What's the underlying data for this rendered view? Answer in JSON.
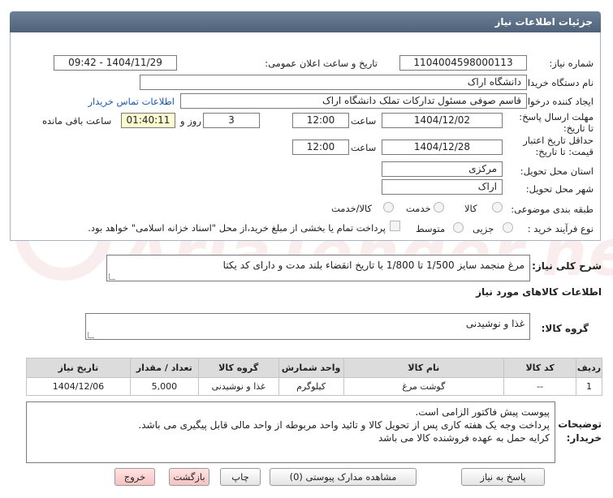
{
  "header": {
    "title": "جزئیات اطلاعات نیاز"
  },
  "form": {
    "need_number": {
      "label": "شماره نیاز:",
      "value": "1104004598000113"
    },
    "announce_datetime": {
      "label": "تاریخ و ساعت اعلان عمومی:",
      "value": "1404/11/29 - 09:42"
    },
    "buyer_org": {
      "label": "نام دستگاه خریدار:",
      "value": "دانشگاه اراک"
    },
    "requester": {
      "label": "ایجاد کننده درخواست:",
      "value": "قاسم صوفی مسئول تدارکات تملک دانشگاه اراک",
      "contact_link": "اطلاعات تماس خریدار"
    },
    "reply_deadline": {
      "label": "مهلت ارسال پاسخ: تا تاریخ:",
      "date": "1404/12/02",
      "time_label": "ساعت",
      "time": "12:00",
      "days": "3",
      "days_label": "روز و",
      "remaining": "01:40:11",
      "remaining_label": "ساعت باقی مانده"
    },
    "price_validity": {
      "label": "حداقل تاریخ اعتبار قیمت: تا تاریخ:",
      "date": "1404/12/28",
      "time_label": "ساعت",
      "time": "12:00"
    },
    "province": {
      "label": "استان محل تحویل:",
      "value": "مرکزی"
    },
    "city": {
      "label": "شهر محل تحویل:",
      "value": "اراک"
    },
    "category": {
      "label": "طبقه بندی موضوعی:",
      "options": [
        "کالا",
        "خدمت",
        "کالا/خدمت"
      ]
    },
    "process_type": {
      "label": "نوع فرآیند خرید :",
      "options": [
        "جزیی",
        "متوسط"
      ],
      "payment_note": "پرداخت تمام یا بخشی از مبلغ خرید،از محل \"اسناد خزانه اسلامی\" خواهد بود."
    }
  },
  "summary": {
    "label": "شرح کلی نیاز:",
    "value": "مرغ منجمد سایز 1/500 تا 1/800 با تاریخ انقضاء بلند مدت و دارای کد یکتا"
  },
  "goods_section": {
    "title": "اطلاعات کالاهای مورد نیاز"
  },
  "goods_group": {
    "label": "گروه کالا:",
    "value": "غذا و نوشیدنی"
  },
  "table": {
    "headers": [
      "ردیف",
      "کد کالا",
      "نام کالا",
      "واحد شمارش",
      "گروه کالا",
      "تعداد / مقدار",
      "تاریخ نیاز"
    ],
    "rows": [
      [
        "1",
        "--",
        "گوشت مرغ",
        "کیلوگرم",
        "غذا و نوشیدنی",
        "5,000",
        "1404/12/06"
      ]
    ]
  },
  "buyer_notes": {
    "label": "توضیحات خریدار:",
    "lines": [
      "پیوست پیش فاکتور الزامی است.",
      "پرداخت وجه یک هفته کاری پس از تحویل کالا و تائید واحد مربوطه از واحد مالی قابل پیگیری می باشد.",
      "کرایه حمل به عهده فروشنده کالا می باشد"
    ]
  },
  "buttons": {
    "reply": "پاسخ به نیاز",
    "view_docs": "مشاهده مدارک پیوستی (0)",
    "print": "چاپ",
    "back": "بازگشت",
    "exit": "خروج"
  },
  "watermark": {
    "text": "AriaTender.net"
  },
  "colors": {
    "header_bg": "#5a6e86",
    "link": "#1a57b0",
    "remaining_bg": "#fdfbd0",
    "pink_button": "#f6c2c2"
  }
}
